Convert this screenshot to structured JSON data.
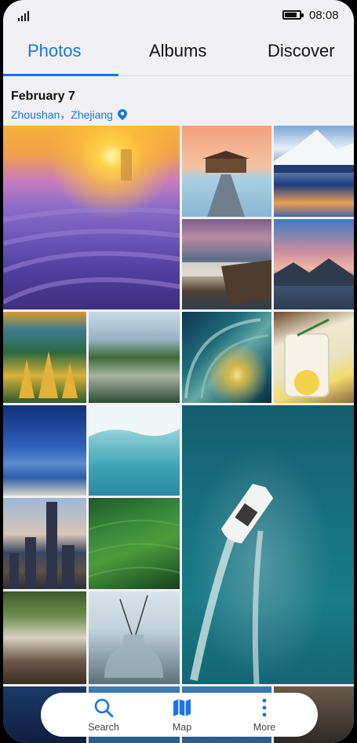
{
  "status_bar": {
    "time": "08:08",
    "battery_level": 0.85,
    "icons": [
      "signal-icon",
      "battery-icon"
    ]
  },
  "tabs": [
    {
      "label": "Photos",
      "active": true
    },
    {
      "label": "Albums",
      "active": false
    },
    {
      "label": "Discover",
      "active": false
    }
  ],
  "group": {
    "date": "February 7",
    "location": "Zhoushan，Zhejiang",
    "location_icon": "location-pin-icon"
  },
  "photos": [
    "lavender-field-sunset",
    "pier-house-sunset",
    "snowy-mountain-lake",
    "waterfall-cliffs",
    "pink-sky-lake",
    "autumn-forest-lake",
    "mountain-forest-reflection",
    "ocean-wave-curl",
    "lemon-drink",
    "night-sky-coast",
    "glacier-ice",
    "speedboat-aerial",
    "city-skyline-dusk",
    "green-hills",
    "village-street",
    "glass-vase-flowers"
  ],
  "bottom_nav": [
    {
      "label": "Search",
      "icon": "search-icon"
    },
    {
      "label": "Map",
      "icon": "map-icon"
    },
    {
      "label": "More",
      "icon": "more-vertical-icon"
    }
  ],
  "colors": {
    "accent": "#1a73e8",
    "background": "#f1f1f3",
    "nav_icon": "#1a73e8"
  }
}
